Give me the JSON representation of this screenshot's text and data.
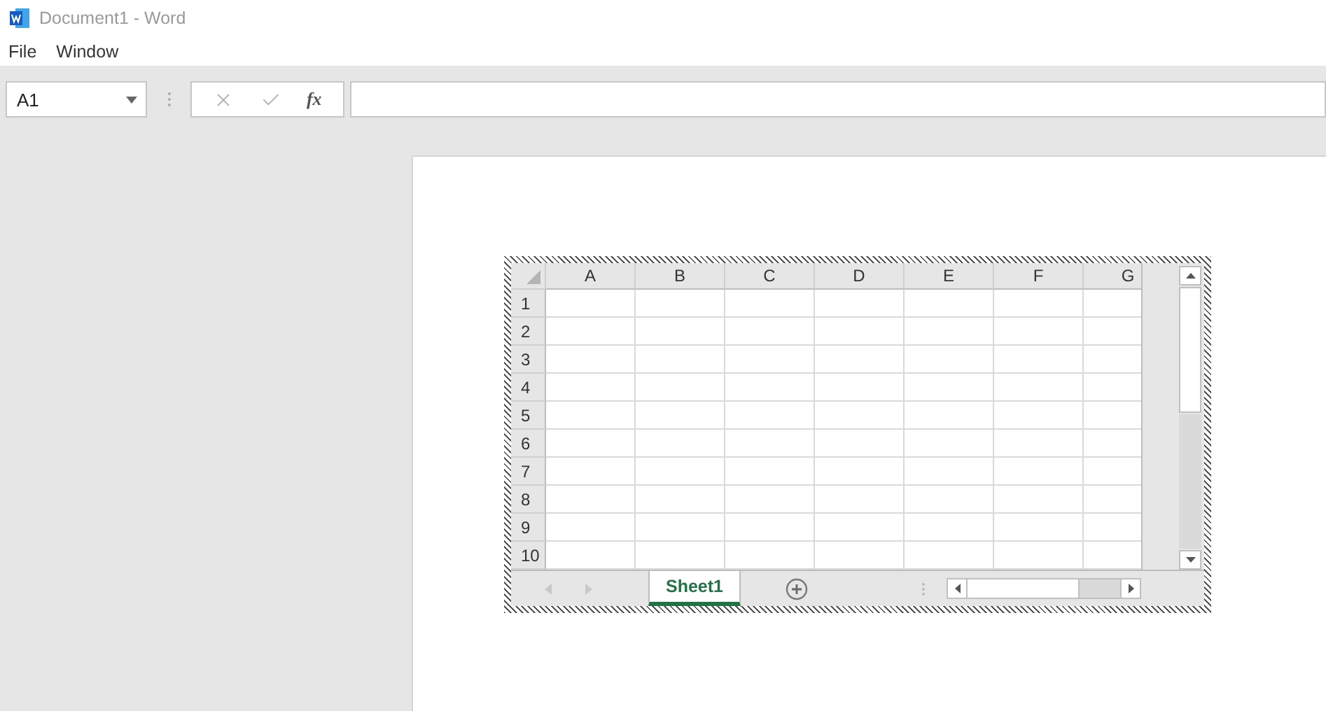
{
  "window": {
    "title": "Document1 - Word"
  },
  "menu": [
    {
      "label": "File"
    },
    {
      "label": "Window"
    }
  ],
  "formula_bar": {
    "name_box": "A1",
    "function_button": "fx"
  },
  "sheet": {
    "columns": [
      "A",
      "B",
      "C",
      "D",
      "E",
      "F",
      "G"
    ],
    "rows": [
      "1",
      "2",
      "3",
      "4",
      "5",
      "6",
      "7",
      "8",
      "9",
      "10"
    ],
    "tabs": [
      {
        "label": "Sheet1",
        "selected": true
      }
    ]
  }
}
